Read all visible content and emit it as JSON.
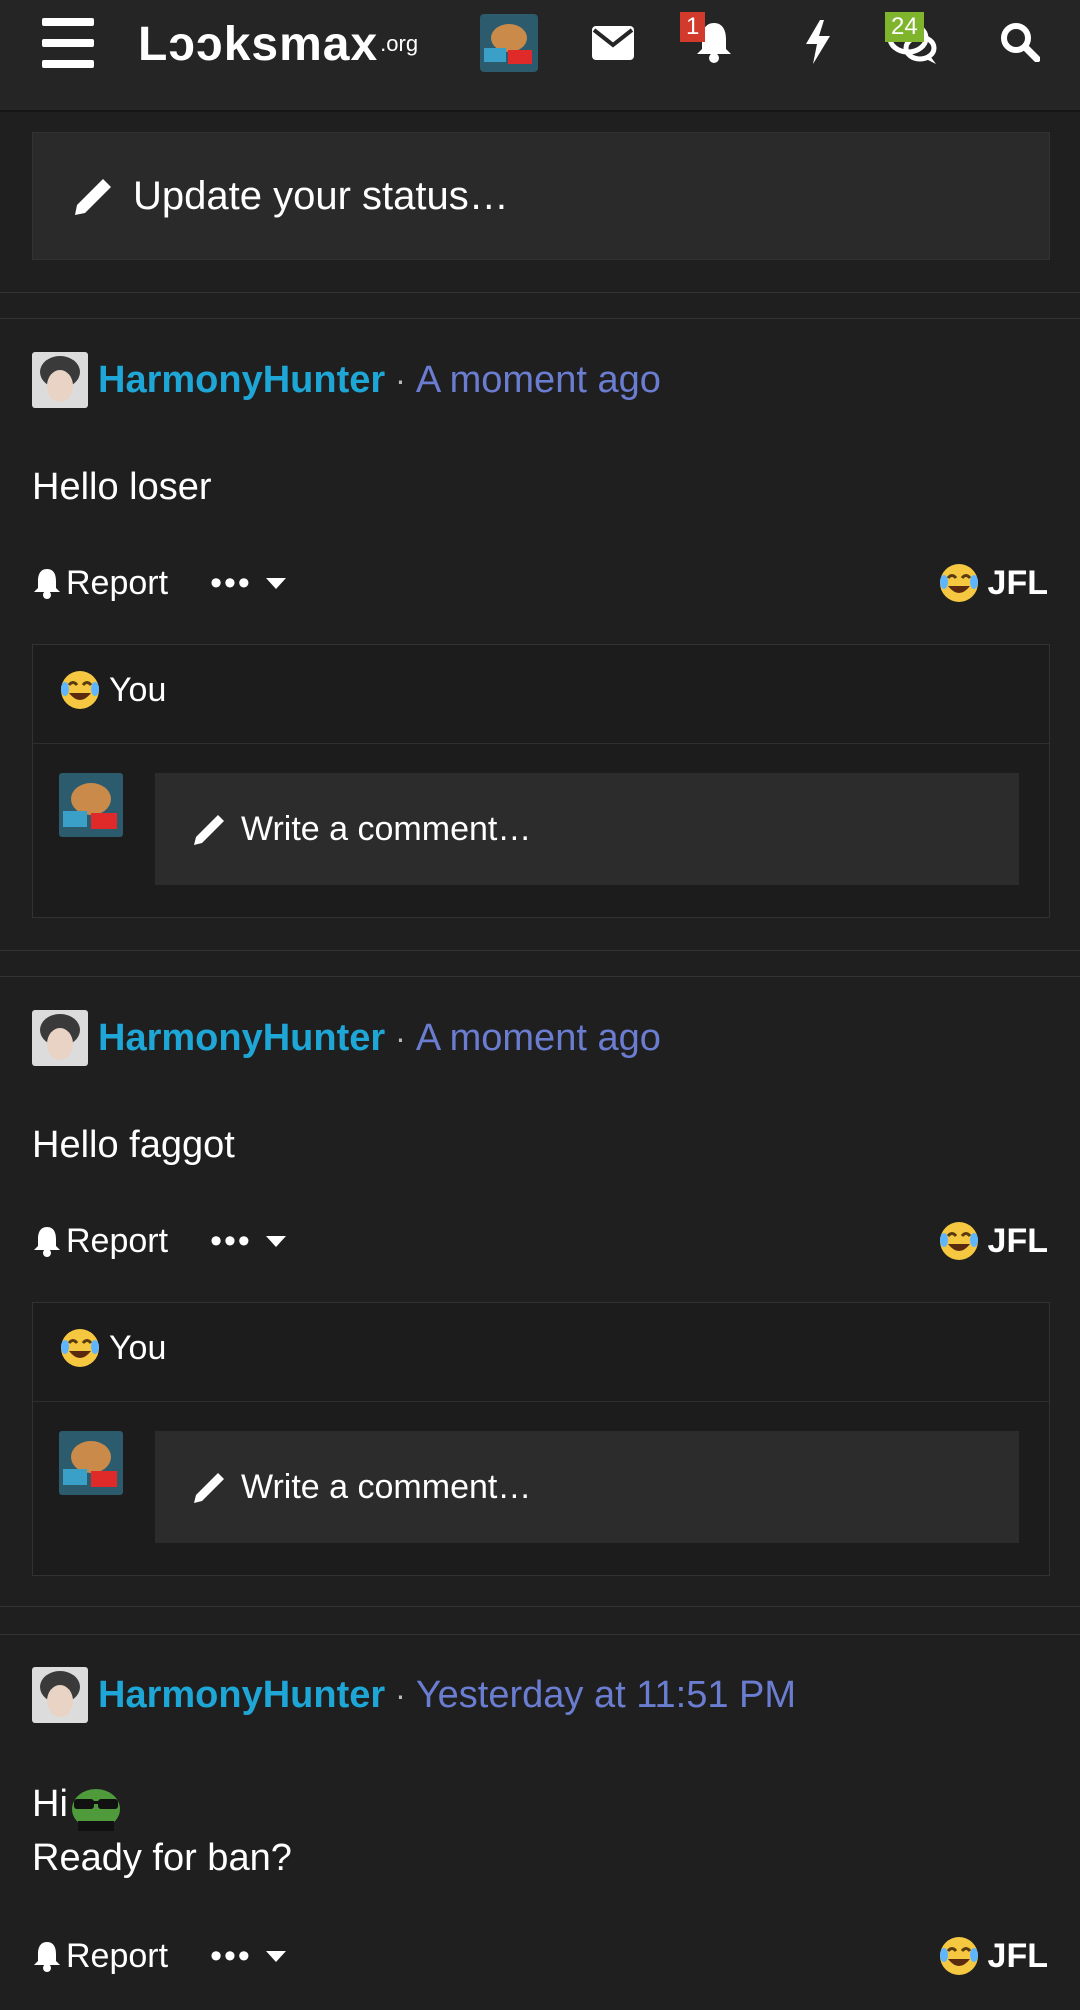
{
  "header": {
    "logo_main": "Lɔɔksmax",
    "logo_tld": ".org",
    "alerts_badge": "1",
    "conversations_badge": "24",
    "icons": [
      "menu-icon",
      "avatar",
      "mail-icon",
      "bell-icon",
      "bolt-icon",
      "chat-icon",
      "search-icon"
    ],
    "accent_red": "#d23b2b",
    "accent_green": "#7fb52d"
  },
  "status": {
    "placeholder": "Update your status…"
  },
  "posts": [
    {
      "author": "HarmonyHunter",
      "time": "A moment ago",
      "body": [
        "Hello loser"
      ],
      "report_label": "Report",
      "more_label": "•••",
      "reaction_label": "JFL",
      "reacted_by": "You",
      "comment_placeholder": "Write a comment…"
    },
    {
      "author": "HarmonyHunter",
      "time": "A moment ago",
      "body": [
        "Hello faggot"
      ],
      "report_label": "Report",
      "more_label": "•••",
      "reaction_label": "JFL",
      "reacted_by": "You",
      "comment_placeholder": "Write a comment…"
    },
    {
      "author": "HarmonyHunter",
      "time": "Yesterday at 11:51 PM",
      "body": [
        "Hi",
        "Ready for ban?"
      ],
      "report_label": "Report",
      "more_label": "•••",
      "reaction_label": "JFL"
    }
  ],
  "colors": {
    "author": "#1ea7d6",
    "time": "#6b7dd1",
    "background": "#1f1f1f"
  }
}
